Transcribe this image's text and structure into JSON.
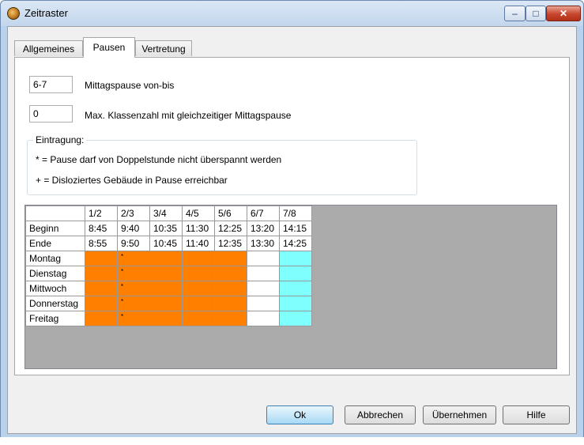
{
  "window": {
    "title": "Zeitraster"
  },
  "titlebar": {
    "min_glyph": "–",
    "max_glyph": "□",
    "close_glyph": "✕"
  },
  "tabs": [
    {
      "label": "Allgemeines",
      "active": false
    },
    {
      "label": "Pausen",
      "active": true
    },
    {
      "label": "Vertretung",
      "active": false
    }
  ],
  "lunch": {
    "value": "6-7",
    "label": "Mittagspause von-bis"
  },
  "max_classes": {
    "value": "0",
    "label": "Max. Klassenzahl mit gleichzeitiger Mittagspause"
  },
  "legend": {
    "title": "Eintragung:",
    "line1": "* = Pause darf von Doppelstunde nicht überspannt werden",
    "line2": "+ = Disloziertes Gebäude in Pause erreichbar"
  },
  "grid": {
    "periods": [
      "1/2",
      "2/3",
      "3/4",
      "4/5",
      "5/6",
      "6/7",
      "7/8"
    ],
    "begin_label": "Beginn",
    "begin": [
      "8:45",
      "9:40",
      "10:35",
      "11:30",
      "12:25",
      "13:20",
      "14:15"
    ],
    "end_label": "Ende",
    "end": [
      "8:55",
      "9:50",
      "10:45",
      "11:40",
      "12:35",
      "13:30",
      "14:25"
    ],
    "days": [
      "Montag",
      "Dienstag",
      "Mittwoch",
      "Donnerstag",
      "Freitag"
    ],
    "cell_mark": "*",
    "cell_states": [
      "orange",
      "orange-star",
      "orange",
      "orange",
      "orange",
      "white",
      "cyan"
    ],
    "colors": {
      "orange": "#ff7f00",
      "cyan": "#80ffff",
      "white": "#ffffff"
    }
  },
  "buttons": {
    "ok": "Ok",
    "cancel": "Abbrechen",
    "apply": "Übernehmen",
    "help": "Hilfe"
  }
}
